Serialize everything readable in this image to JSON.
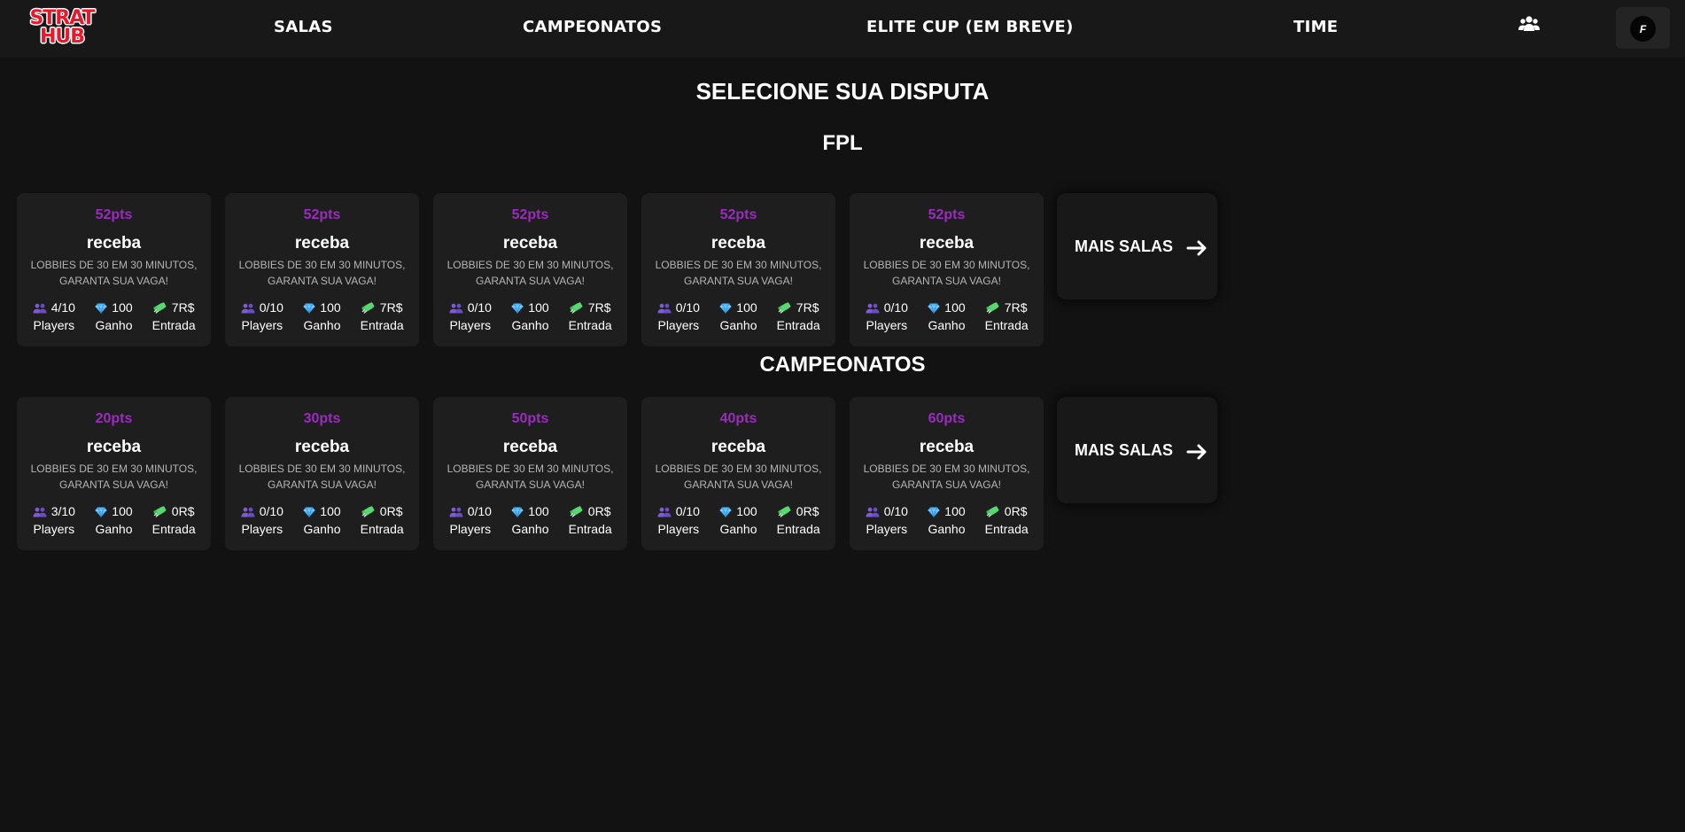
{
  "header": {
    "logo_line1": "STRAT",
    "logo_line2": "HUB",
    "nav": [
      {
        "label": "SALAS"
      },
      {
        "label": "CAMPEONATOS"
      },
      {
        "label": "ELITE CUP (EM BREVE)"
      },
      {
        "label": "TIME"
      }
    ],
    "team_icon": "users-icon",
    "profile_initial": "F"
  },
  "page_title": "SELECIONE SUA DISPUTA",
  "colors": {
    "background": "#121212",
    "header": "#181818",
    "card": "#1e1e1e",
    "points": "#9b2bbf",
    "players_icon": "#7b5bd6",
    "diamond_icon": "#4fb8ff",
    "money_icon": "#3ec45a"
  },
  "sections": [
    {
      "title": "FPL",
      "more_label": "MAIS SALAS",
      "cards": [
        {
          "points": "52pts",
          "name": "receba",
          "desc1": "LOBBIES DE 30 EM 30 MINUTOS,",
          "desc2": "GARANTA SUA VAGA!",
          "players": "4/10",
          "prize": "100",
          "fee": "7R$",
          "players_label": "Players",
          "prize_label": "Ganho",
          "fee_label": "Entrada"
        },
        {
          "points": "52pts",
          "name": "receba",
          "desc1": "LOBBIES DE 30 EM 30 MINUTOS,",
          "desc2": "GARANTA SUA VAGA!",
          "players": "0/10",
          "prize": "100",
          "fee": "7R$",
          "players_label": "Players",
          "prize_label": "Ganho",
          "fee_label": "Entrada"
        },
        {
          "points": "52pts",
          "name": "receba",
          "desc1": "LOBBIES DE 30 EM 30 MINUTOS,",
          "desc2": "GARANTA SUA VAGA!",
          "players": "0/10",
          "prize": "100",
          "fee": "7R$",
          "players_label": "Players",
          "prize_label": "Ganho",
          "fee_label": "Entrada"
        },
        {
          "points": "52pts",
          "name": "receba",
          "desc1": "LOBBIES DE 30 EM 30 MINUTOS,",
          "desc2": "GARANTA SUA VAGA!",
          "players": "0/10",
          "prize": "100",
          "fee": "7R$",
          "players_label": "Players",
          "prize_label": "Ganho",
          "fee_label": "Entrada"
        },
        {
          "points": "52pts",
          "name": "receba",
          "desc1": "LOBBIES DE 30 EM 30 MINUTOS,",
          "desc2": "GARANTA SUA VAGA!",
          "players": "0/10",
          "prize": "100",
          "fee": "7R$",
          "players_label": "Players",
          "prize_label": "Ganho",
          "fee_label": "Entrada"
        }
      ]
    },
    {
      "title": "CAMPEONATOS",
      "more_label": "MAIS SALAS",
      "cards": [
        {
          "points": "20pts",
          "name": "receba",
          "desc1": "LOBBIES DE 30 EM 30 MINUTOS,",
          "desc2": "GARANTA SUA VAGA!",
          "players": "3/10",
          "prize": "100",
          "fee": "0R$",
          "players_label": "Players",
          "prize_label": "Ganho",
          "fee_label": "Entrada"
        },
        {
          "points": "30pts",
          "name": "receba",
          "desc1": "LOBBIES DE 30 EM 30 MINUTOS,",
          "desc2": "GARANTA SUA VAGA!",
          "players": "0/10",
          "prize": "100",
          "fee": "0R$",
          "players_label": "Players",
          "prize_label": "Ganho",
          "fee_label": "Entrada"
        },
        {
          "points": "50pts",
          "name": "receba",
          "desc1": "LOBBIES DE 30 EM 30 MINUTOS,",
          "desc2": "GARANTA SUA VAGA!",
          "players": "0/10",
          "prize": "100",
          "fee": "0R$",
          "players_label": "Players",
          "prize_label": "Ganho",
          "fee_label": "Entrada"
        },
        {
          "points": "40pts",
          "name": "receba",
          "desc1": "LOBBIES DE 30 EM 30 MINUTOS,",
          "desc2": "GARANTA SUA VAGA!",
          "players": "0/10",
          "prize": "100",
          "fee": "0R$",
          "players_label": "Players",
          "prize_label": "Ganho",
          "fee_label": "Entrada"
        },
        {
          "points": "60pts",
          "name": "receba",
          "desc1": "LOBBIES DE 30 EM 30 MINUTOS,",
          "desc2": "GARANTA SUA VAGA!",
          "players": "0/10",
          "prize": "100",
          "fee": "0R$",
          "players_label": "Players",
          "prize_label": "Ganho",
          "fee_label": "Entrada"
        }
      ]
    }
  ]
}
